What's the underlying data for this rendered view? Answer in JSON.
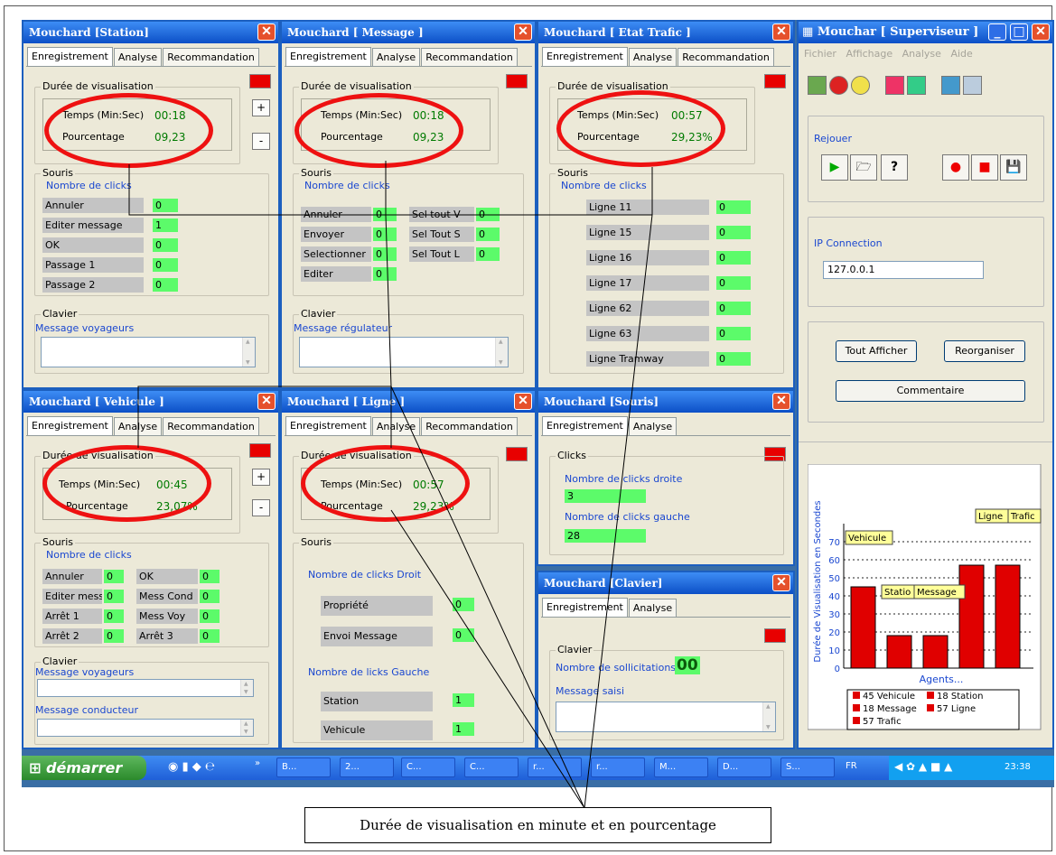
{
  "station": {
    "title": "Mouchard [Station]",
    "tabs": [
      "Enregistrement",
      "Analyse",
      "Recommandation"
    ],
    "duree": "Durée de visualisation",
    "temps_label": "Temps (Min:Sec)",
    "temps": "00:18",
    "pct_label": "Pourcentage",
    "pct": "09,23",
    "souris": "Souris",
    "nb_clicks": "Nombre de clicks",
    "rows": [
      {
        "label": "Annuler",
        "value": "0"
      },
      {
        "label": "Editer message",
        "value": "1"
      },
      {
        "label": "OK",
        "value": "0"
      },
      {
        "label": "Passage 1",
        "value": "0"
      },
      {
        "label": "Passage 2",
        "value": "0"
      }
    ],
    "clavier": "Clavier",
    "msg": "Message voyageurs",
    "plus": "+",
    "minus": "-"
  },
  "message": {
    "title": "Mouchard [ Message ]",
    "tabs": [
      "Enregistrement",
      "Analyse",
      "Recommandation"
    ],
    "duree": "Durée de visualisation",
    "temps_label": "Temps (Min:Sec)",
    "temps": "00:18",
    "pct_label": "Pourcentage",
    "pct": "09,23",
    "souris": "Souris",
    "nb_clicks": "Nombre de clicks",
    "left": [
      {
        "label": "Annuler",
        "value": "0"
      },
      {
        "label": "Envoyer",
        "value": "0"
      },
      {
        "label": "Selectionner",
        "value": "0"
      },
      {
        "label": "Editer",
        "value": "0"
      }
    ],
    "right": [
      {
        "label": "Sel tout V",
        "value": "0"
      },
      {
        "label": "Sel Tout S",
        "value": "0"
      },
      {
        "label": "Sel Tout L",
        "value": "0"
      }
    ],
    "clavier": "Clavier",
    "msg": "Message régulateur"
  },
  "trafic": {
    "title": "Mouchard [ Etat Trafic ]",
    "tabs": [
      "Enregistrement",
      "Analyse",
      "Recommandation"
    ],
    "duree": "Durée de visualisation",
    "temps_label": "Temps (Min:Sec)",
    "temps": "00:57",
    "pct_label": "Pourcentage",
    "pct": "29,23%",
    "souris": "Souris",
    "nb_clicks": "Nombre de clicks",
    "rows": [
      {
        "label": "Ligne 11",
        "value": "0"
      },
      {
        "label": "Ligne 15",
        "value": "0"
      },
      {
        "label": "Ligne 16",
        "value": "0"
      },
      {
        "label": "Ligne 17",
        "value": "0"
      },
      {
        "label": "Ligne 62",
        "value": "0"
      },
      {
        "label": "Ligne 63",
        "value": "0"
      },
      {
        "label": "Ligne Tramway",
        "value": "0"
      }
    ]
  },
  "vehicule": {
    "title": "Mouchard [ Vehicule ]",
    "tabs": [
      "Enregistrement",
      "Analyse",
      "Recommandation"
    ],
    "duree": "Durée de visualisation",
    "temps_label": "Temps (Min:Sec)",
    "temps": "00:45",
    "pct_label": "Pourcentage",
    "pct": "23,07%",
    "souris": "Souris",
    "nb_clicks": "Nombre de clicks",
    "left": [
      {
        "label": "Annuler",
        "value": "0"
      },
      {
        "label": "Editer mess",
        "value": "0"
      },
      {
        "label": "Arrêt 1",
        "value": "0"
      },
      {
        "label": "Arrêt 2",
        "value": "0"
      }
    ],
    "right": [
      {
        "label": "OK",
        "value": "0"
      },
      {
        "label": "Mess Cond",
        "value": "0"
      },
      {
        "label": "Mess Voy",
        "value": "0"
      },
      {
        "label": "Arrêt 3",
        "value": "0"
      }
    ],
    "clavier": "Clavier",
    "msg1": "Message voyageurs",
    "msg2": "Message conducteur",
    "plus": "+",
    "minus": "-"
  },
  "ligne": {
    "title": "Mouchard [ Ligne ]",
    "tabs": [
      "Enregistrement",
      "Analyse",
      "Recommandation"
    ],
    "duree": "Durée de visualisation",
    "temps_label": "Temps (Min:Sec)",
    "temps": "00:57",
    "pct_label": "Pourcentage",
    "pct": "29,23%",
    "souris": "Souris",
    "droit": "Nombre de clicks Droit",
    "droit_rows": [
      {
        "label": "Propriété",
        "value": "0"
      },
      {
        "label": "Envoi Message",
        "value": "0"
      }
    ],
    "gauche": "Nombre de licks Gauche",
    "gauche_rows": [
      {
        "label": "Station",
        "value": "1"
      },
      {
        "label": "Vehicule",
        "value": "1"
      }
    ]
  },
  "souris": {
    "title": "Mouchard [Souris]",
    "tabs": [
      "Enregistrement",
      "Analyse"
    ],
    "clicks": "Clicks",
    "droite": "Nombre de clicks droite",
    "droite_val": "3",
    "gauche": "Nombre de clicks gauche",
    "gauche_val": "28"
  },
  "clavier": {
    "title": "Mouchard [Clavier]",
    "tabs": [
      "Enregistrement",
      "Analyse"
    ],
    "grp": "Clavier",
    "sollic": "Nombre de sollicitations",
    "sollic_val": "00",
    "saisi": "Message saisi"
  },
  "superviseur": {
    "title": "Mouchar [ Superviseur ]",
    "menu": [
      "Fichier",
      "Affichage",
      "Analyse",
      "Aide"
    ],
    "rejouer": "Rejouer",
    "ip_label": "IP Connection",
    "ip": "127.0.0.1",
    "tout": "Tout Afficher",
    "reorg": "Reorganiser",
    "comment": "Commentaire"
  },
  "chart_data": {
    "type": "bar",
    "categories": [
      "Vehicule",
      "Station",
      "Message",
      "Ligne",
      "Trafic"
    ],
    "values": [
      45,
      18,
      18,
      57,
      57
    ],
    "ylabel": "Durée de Visualisation en Secondes",
    "xlabel": "Agents...",
    "ylim": [
      0,
      80
    ],
    "yticks": [
      0,
      10,
      20,
      30,
      40,
      50,
      60,
      70
    ],
    "color": "#e00000",
    "grid": true,
    "annotations": [
      "Ligne",
      "Trafic",
      "Vehicule",
      "Statio",
      "Message"
    ],
    "legend": [
      "45 Vehicule",
      "18 Station",
      "18 Message",
      "57 Ligne",
      "57 Trafic"
    ],
    "legend_position": "bottom"
  },
  "taskbar": {
    "start": "démarrer",
    "tasks": [
      "B...",
      "2...",
      "C...",
      "C...",
      "r...",
      "r...",
      "M...",
      "D...",
      "S..."
    ],
    "lang": "FR",
    "clock": "23:38"
  },
  "caption": "Durée de visualisation en minute et en pourcentage",
  "colors": {
    "title_bar": "#0c4fc6",
    "window_bg": "#ece9d8",
    "green": "#5cfb6a",
    "red": "#e80000",
    "oval": "#e11111"
  }
}
